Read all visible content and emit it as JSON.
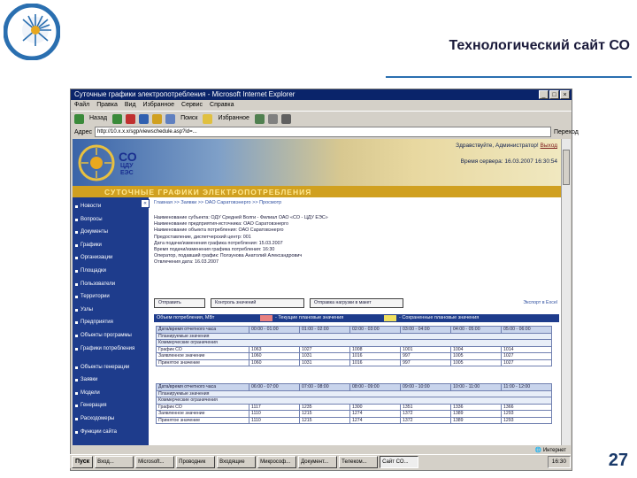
{
  "slide": {
    "title": "Технологический сайт СО",
    "number": "27"
  },
  "browser": {
    "window_title": "Суточные графики электропотребления - Microsoft Internet Explorer",
    "menu": [
      "Файл",
      "Правка",
      "Вид",
      "Избранное",
      "Сервис",
      "Справка"
    ],
    "toolbar": {
      "back": "Назад",
      "search": "Поиск",
      "favorites": "Избранное"
    },
    "address_label": "Адрес",
    "address_value": "http://10.x.x.x/sgp/viewschedule.asp?id=...",
    "go_label": "Переход",
    "status_zone": "Интернет"
  },
  "banner": {
    "welcome": "Здравствуйте, Администратор!",
    "exit": "Выход",
    "server_time": "Время сервера: 16.03.2007 16:30:54",
    "logo_co": "СО",
    "logo_cdu": "ЦДУ",
    "logo_ees": "ЕЭС",
    "strip_title": "СУТОЧНЫЕ ГРАФИКИ ЭЛЕКТРОПОТРЕБЛЕНИЯ"
  },
  "sidebar": {
    "collapse": "«",
    "items": [
      "Новости",
      "Вопросы",
      "Документы",
      "Графики",
      "Организации",
      "Площадки",
      "Пользователи",
      "Территории",
      "Узлы",
      "Предприятия",
      "Объекты программы",
      "Графики потребления",
      "Объекты генерации",
      "Заявки",
      "Модели",
      "Генерация",
      "Расходомеры",
      "Функции сайта"
    ]
  },
  "content": {
    "breadcrumb": "Главная >> Заявки >> ОАО Саратовэнерго >> Просмотр",
    "info_lines": [
      "Наименование субъекта: ОДУ Средней Волги - Филиал ОАО «СО - ЦДУ ЕЭС»",
      "Наименование предприятия-источника: ОАО Саратовэнерго",
      "Наименование объекта потребления: ОАО Саратовэнерго",
      "Предоставление, диспетчерский центр: 001",
      "Дата подачи/изменения графика потребления: 15.03.2007",
      "Время подачи/изменения графика потребления: 16:30",
      "Оператор, подавший график: Ползунова Анатолий Александрович",
      "Отвлечения дата: 16.03.2007"
    ],
    "actions": [
      "Отправить",
      "Контроль значений",
      "Отправка нагрузки в макет"
    ],
    "to_excel": "Экспорт в Excel",
    "obem": {
      "label": "Объем потребления, МВт",
      "legend_red": "- Текущие плановые значения",
      "legend_yellow": "- Сохраненные плановые значения",
      "red": "#e88080",
      "yellow": "#f0e060"
    },
    "table1": {
      "header": [
        "Дата/время отчетного часа",
        "00:00 - 01:00",
        "01:00 - 02:00",
        "02:00 - 03:00",
        "03:00 - 04:00",
        "04:00 - 05:00",
        "05:00 - 06:00"
      ],
      "sub_rows": [
        "Планируемые значения",
        "Коммерческие ограничения"
      ],
      "rows": [
        [
          "График СО",
          "1063",
          "1027",
          "1008",
          "1001",
          "1004",
          "1014"
        ],
        [
          "Заявленное значение",
          "1060",
          "1031",
          "1016",
          "997",
          "1005",
          "1027"
        ],
        [
          "Принятое значение",
          "1060",
          "1031",
          "1016",
          "997",
          "1005",
          "1027"
        ]
      ]
    },
    "table2": {
      "header": [
        "Дата/время отчетного часа",
        "06:00 - 07:00",
        "07:00 - 08:00",
        "08:00 - 09:00",
        "09:00 - 10:00",
        "10:00 - 11:00",
        "11:00 - 12:00"
      ],
      "sub_rows": [
        "Планируемые значения",
        "Коммерческие ограничения"
      ],
      "rows": [
        [
          "График СО",
          "1117",
          "1235",
          "1300",
          "1351",
          "1336",
          "1366"
        ],
        [
          "Заявленное значение",
          "1110",
          "1215",
          "1274",
          "1372",
          "1389",
          "1293"
        ],
        [
          "Принятое значение",
          "1110",
          "1215",
          "1274",
          "1372",
          "1389",
          "1293"
        ]
      ]
    }
  },
  "taskbar": {
    "start": "Пуск",
    "tasks": [
      "Вход...",
      "Microsoft...",
      "Проводник",
      "Входящие",
      "Микрософ...",
      "Документ...",
      "Телеком...",
      "Сайт СО..."
    ],
    "tray_time": "16:30"
  }
}
